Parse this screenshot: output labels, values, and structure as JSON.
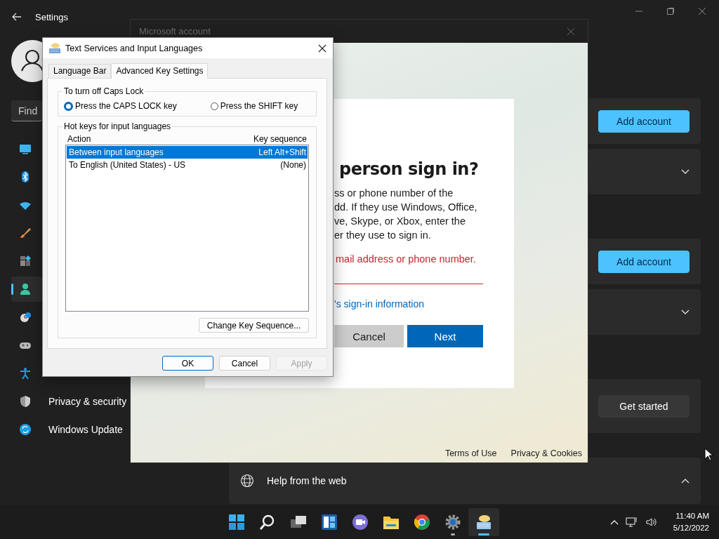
{
  "settings": {
    "title": "Settings",
    "search": {
      "placeholder": "Find"
    },
    "nav": [
      {
        "selected": false
      },
      {
        "selected": false
      },
      {
        "selected": false
      },
      {
        "selected": false
      },
      {
        "selected": false
      },
      {
        "selected": true
      },
      {
        "selected": false
      },
      {
        "selected": false
      },
      {
        "selected": false
      },
      {
        "label": "Privacy & security",
        "selected": false
      },
      {
        "label": "Windows Update",
        "selected": false
      }
    ],
    "sections": [
      [
        {
          "kind": "button",
          "button": "Add account",
          "primary": true
        },
        {
          "kind": "expander",
          "expanded": false
        }
      ],
      [
        {
          "kind": "button",
          "button": "Add account",
          "primary": true
        },
        {
          "kind": "expander",
          "expanded": false
        }
      ],
      [
        {
          "kind": "button",
          "button": "Get started",
          "primary": false
        }
      ],
      [
        {
          "kind": "expander",
          "label": "Help from the web",
          "expanded": true
        }
      ]
    ]
  },
  "account_window": {
    "title": "Microsoft account",
    "heading": "person sign in?",
    "lines": [
      "ss or phone number of the",
      "dd. If they use Windows, Office,",
      "ve, Skype, or Xbox, enter the",
      "er they use to sign in."
    ],
    "error": "mail address or phone number.",
    "link": "'s sign-in information",
    "buttons": [
      {
        "label": "Cancel",
        "primary": false
      },
      {
        "label": "Next",
        "primary": true
      }
    ],
    "footer": [
      "Terms of Use",
      "Privacy & Cookies"
    ]
  },
  "dialog": {
    "title": "Text Services and Input Languages",
    "tabs": [
      {
        "label": "Language Bar",
        "selected": false
      },
      {
        "label": "Advanced Key Settings",
        "selected": true
      }
    ],
    "caps_lock": {
      "title": "To turn off Caps Lock",
      "options": [
        {
          "label": "Press the CAPS LOCK key",
          "selected": true
        },
        {
          "label": "Press the SHIFT key",
          "selected": false
        }
      ]
    },
    "hotkeys": {
      "title": "Hot keys for input languages",
      "columns": [
        "Action",
        "Key sequence"
      ],
      "rows": [
        {
          "action": "Between input languages",
          "keys": "Left Alt+Shift",
          "selected": true
        },
        {
          "action": "To English (United States) - US",
          "keys": "(None)",
          "selected": false
        }
      ],
      "button": "Change Key Sequence..."
    },
    "buttons": [
      {
        "label": "OK",
        "default": true,
        "disabled": false
      },
      {
        "label": "Cancel",
        "default": false,
        "disabled": false
      },
      {
        "label": "Apply",
        "default": false,
        "disabled": true
      }
    ]
  },
  "taskbar": {
    "apps": [
      {
        "running": false,
        "active": false
      },
      {
        "running": false,
        "active": false
      },
      {
        "running": false,
        "active": false
      },
      {
        "running": false,
        "active": false
      },
      {
        "running": false,
        "active": false
      },
      {
        "running": false,
        "active": false
      },
      {
        "running": false,
        "active": false
      },
      {
        "running": true,
        "active": false
      },
      {
        "running": true,
        "active": true
      }
    ],
    "time": "11:40 AM",
    "date": "5/12/2022"
  }
}
